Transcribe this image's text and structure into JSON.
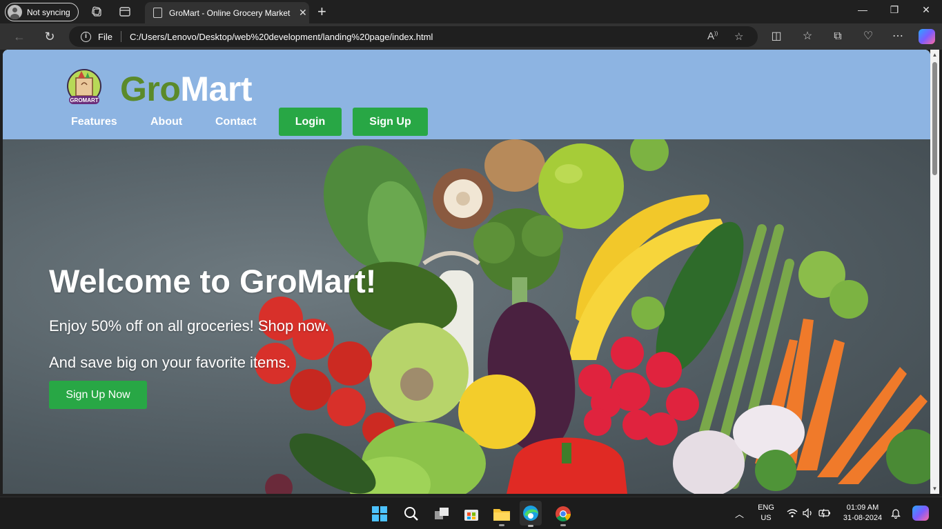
{
  "browser": {
    "profile_label": "Not syncing",
    "tab_title": "GroMart - Online Grocery Market",
    "address_scheme": "File",
    "address_url": "C:/Users/Lenovo/Desktop/web%20development/landing%20page/index.html"
  },
  "site": {
    "logo_text": "GROMART",
    "brand_part1": "Gro",
    "brand_part2": "Mart",
    "nav": {
      "features": "Features",
      "about": "About",
      "contact": "Contact",
      "login": "Login",
      "signup": "Sign Up"
    },
    "hero": {
      "title": "Welcome to GroMart!",
      "line1": "Enjoy 50% off on all groceries! Shop now.",
      "line2": "And save big on your favorite items.",
      "cta": "Sign Up Now"
    },
    "colors": {
      "header_bg": "#8db4e2",
      "brand_green": "#5b8a2a",
      "button_green": "#28a745"
    }
  },
  "taskbar": {
    "lang_top": "ENG",
    "lang_bottom": "US",
    "time": "01:09 AM",
    "date": "31-08-2024"
  }
}
